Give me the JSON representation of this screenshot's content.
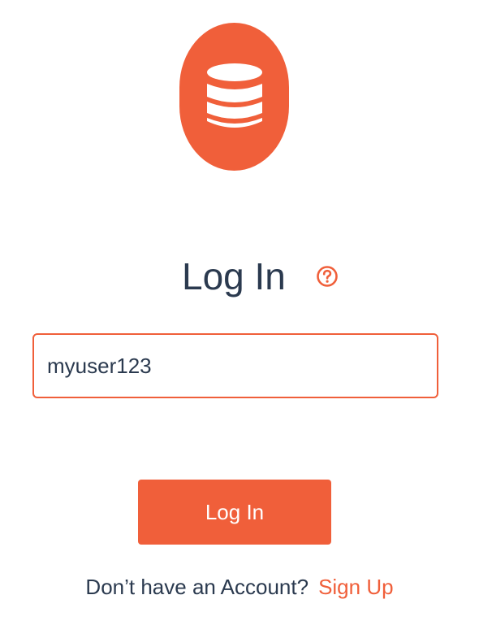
{
  "colors": {
    "accent": "#f05f3a",
    "text": "#2b3a4f",
    "background": "#ffffff"
  },
  "logo": {
    "icon": "database-icon"
  },
  "header": {
    "title": "Log In",
    "help_icon": "help-circle-icon"
  },
  "form": {
    "username_value": "myuser123",
    "login_button_label": "Log In"
  },
  "footer": {
    "prompt": "Don’t have an Account?",
    "signup_label": "Sign Up"
  }
}
